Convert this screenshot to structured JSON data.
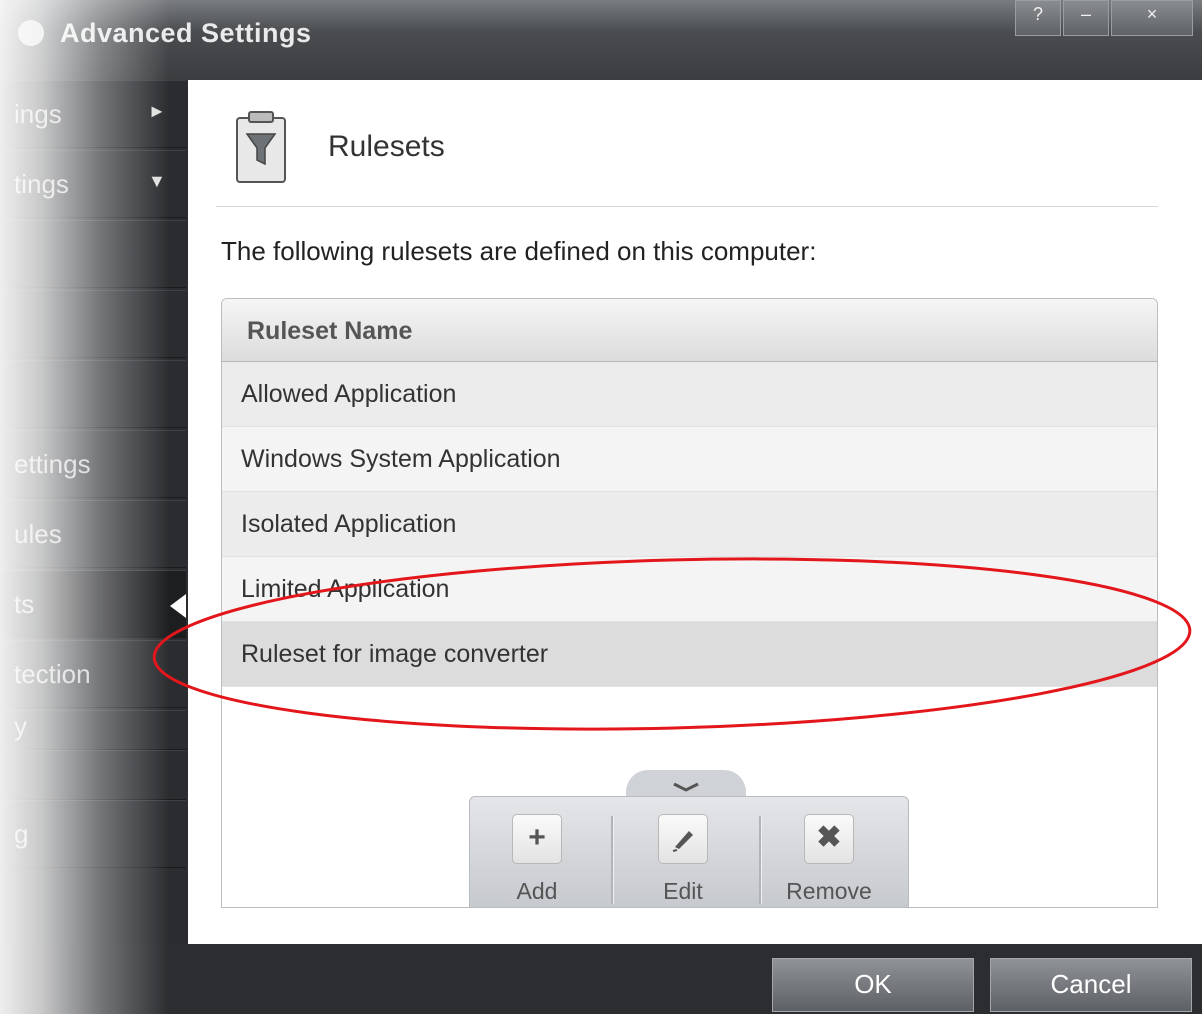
{
  "window": {
    "title": "Advanced Settings",
    "help_label": "?",
    "minimize_label": "–",
    "close_label": "×"
  },
  "sidebar": {
    "items": [
      {
        "label": "ings",
        "arrow": "►"
      },
      {
        "label": "tings",
        "arrow": "▼"
      },
      {
        "label": ""
      },
      {
        "label": ""
      },
      {
        "label": ""
      },
      {
        "label": "ettings"
      },
      {
        "label": "ules"
      },
      {
        "label": "ts"
      },
      {
        "label": "tection"
      },
      {
        "label": "y"
      },
      {
        "label": ""
      },
      {
        "label": "g"
      }
    ]
  },
  "main": {
    "title": "Rulesets",
    "description": "The following rulesets are defined on this computer:",
    "table": {
      "header": "Ruleset Name",
      "rows": [
        "Allowed Application",
        "Windows System Application",
        "Isolated Application",
        "Limited Application",
        "Ruleset for image converter"
      ]
    },
    "toolbar": {
      "add_label": "Add",
      "edit_label": "Edit",
      "remove_label": "Remove",
      "add_icon": "+",
      "remove_icon": "✖"
    }
  },
  "footer": {
    "ok_label": "OK",
    "cancel_label": "Cancel"
  },
  "colors": {
    "annotation": "#e3161b",
    "sidebar_bg": "#2a2c2f",
    "button_bg": "#6f7276"
  }
}
